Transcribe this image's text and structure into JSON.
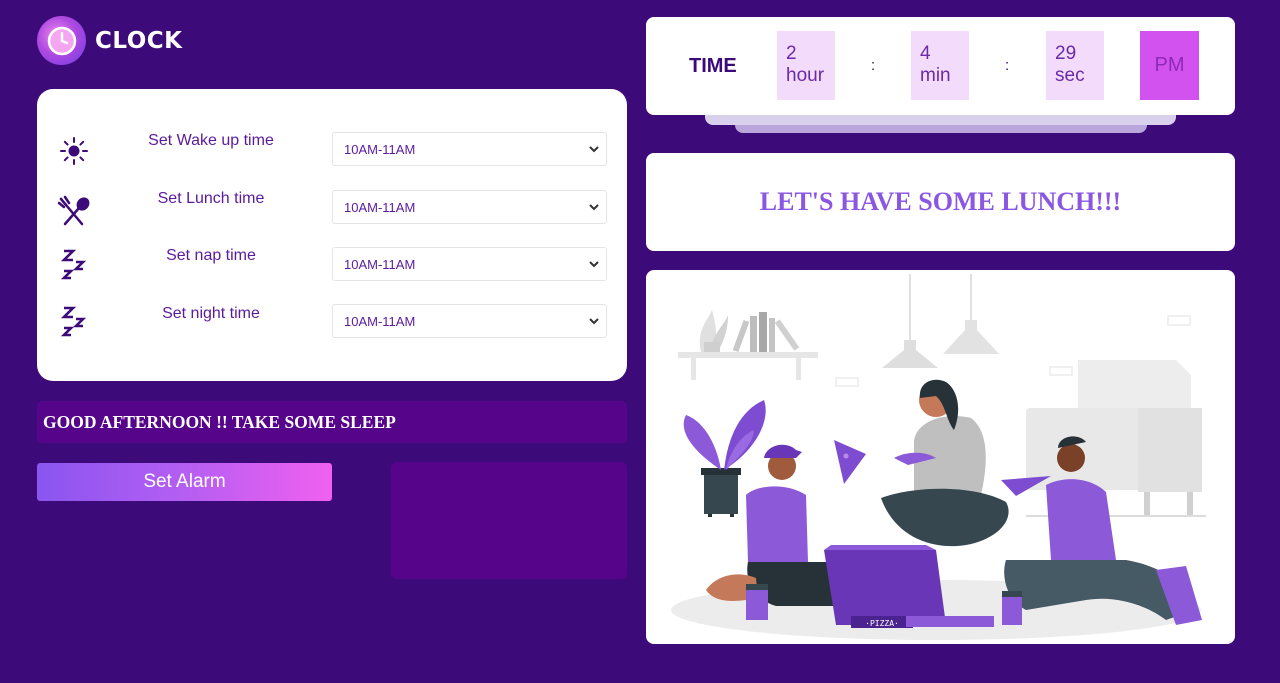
{
  "app": {
    "logo_text": "CLOCK",
    "logo_icon": "clock-icon"
  },
  "settings": [
    {
      "icon": "sun-icon",
      "label": "Set Wake up time",
      "value": "10AM-11AM"
    },
    {
      "icon": "fork-spoon-icon",
      "label": "Set Lunch time",
      "value": "10AM-11AM"
    },
    {
      "icon": "zzz-icon",
      "label": "Set nap time",
      "value": "10AM-11AM"
    },
    {
      "icon": "zzz-icon",
      "label": "Set night time",
      "value": "10AM-11AM"
    }
  ],
  "message": "GOOD AFTERNOON !! TAKE SOME SLEEP",
  "alarm_button_label": "Set Alarm",
  "time": {
    "title": "TIME",
    "hour_value": "2",
    "hour_unit": "hour",
    "min_value": "4",
    "min_unit": "min",
    "sec_value": "29",
    "sec_unit": "sec",
    "separator": ":",
    "ampm": "PM"
  },
  "banner": "LET'S HAVE SOME LUNCH!!!",
  "illustration": {
    "pizza_label": "·PIZZA·"
  },
  "colors": {
    "background": "#3d0a7a",
    "panel_purple": "#56048a",
    "accent": "#8a56e2",
    "ampm_box": "#d152ee"
  }
}
